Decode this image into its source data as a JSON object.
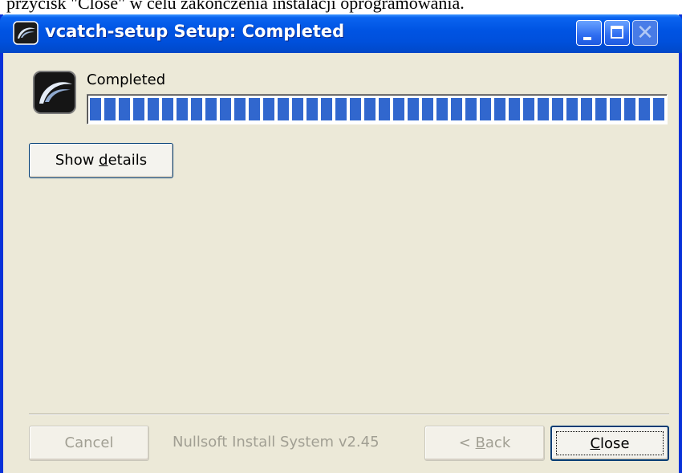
{
  "page_caption": "przycisk \"Close\" w celu zakończenia instalacji oprogramowania.",
  "window": {
    "title": "vcatch-setup Setup: Completed",
    "icon": "nsis-fish-icon"
  },
  "title_buttons": {
    "minimize": "minimize-icon",
    "maximize": "maximize-icon",
    "close": "✕"
  },
  "status": {
    "label": "Completed",
    "progress_fraction": 1.0
  },
  "buttons": {
    "show_details_pre": "Show ",
    "show_details_accel": "d",
    "show_details_post": "etails",
    "cancel": "Cancel",
    "back_pre": "< ",
    "back_accel": "B",
    "back_post": "ack",
    "close_accel": "C",
    "close_post": "lose"
  },
  "footer": {
    "branding": "Nullsoft Install System v2.45"
  },
  "colors": {
    "titlebar": "#0054e3",
    "progress": "#3167ce",
    "face": "#ece9d8"
  }
}
